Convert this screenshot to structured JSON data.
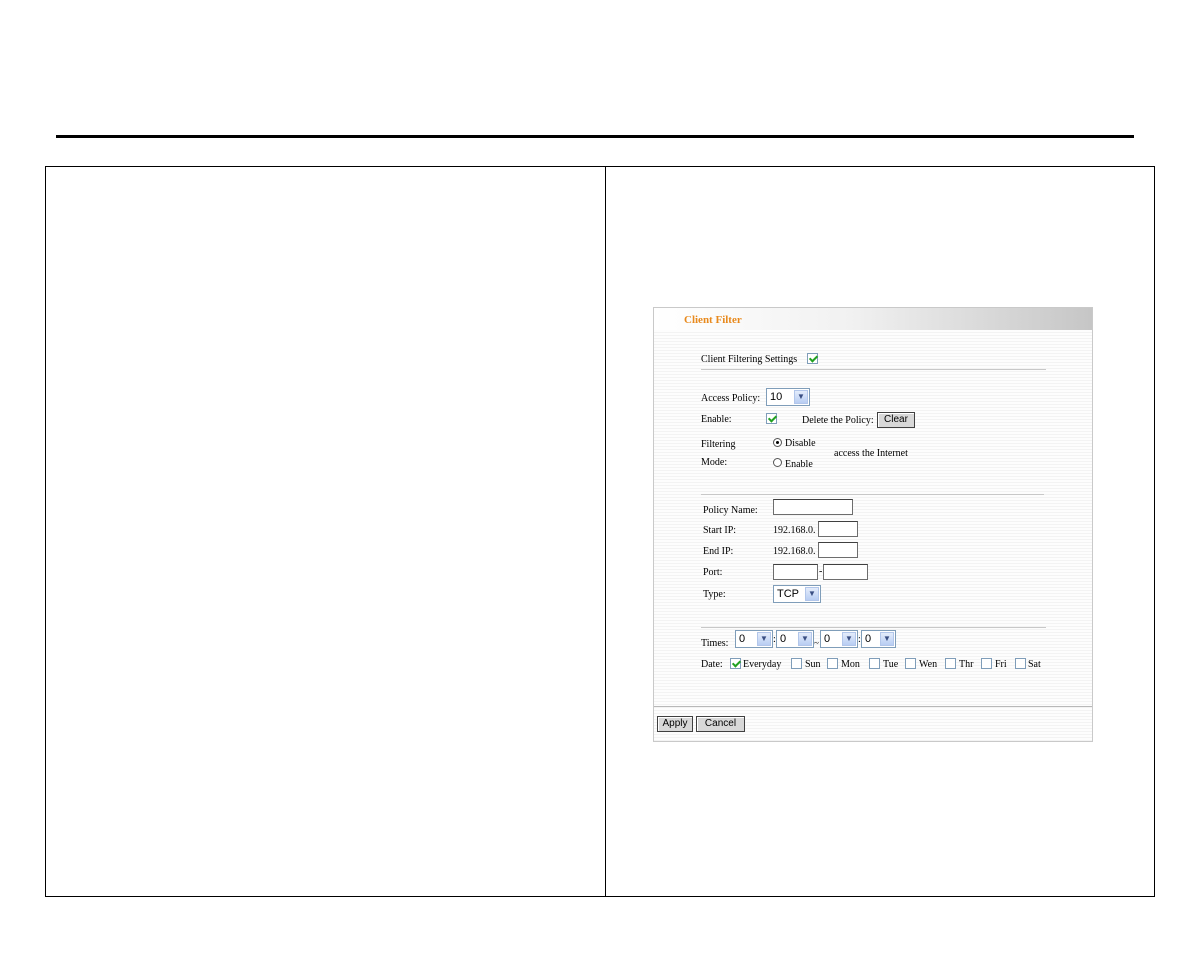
{
  "panel": {
    "title": "Client Filter",
    "client_filtering_settings_label": "Client Filtering Settings",
    "access_policy": {
      "label": "Access Policy:",
      "value": "10"
    },
    "enable_label": "Enable:",
    "delete_policy_label": "Delete the Policy:",
    "clear_button": "Clear",
    "filtering_mode": {
      "label_line1": "Filtering",
      "label_line2": "Mode:",
      "option_disable": "Disable",
      "option_enable": "Enable",
      "suffix": "access the Internet"
    },
    "policy_name_label": "Policy Name:",
    "start_ip": {
      "label": "Start IP:",
      "prefix": "192.168.0."
    },
    "end_ip": {
      "label": "End IP:",
      "prefix": "192.168.0."
    },
    "port_label": "Port:",
    "port_separator": "-",
    "type": {
      "label": "Type:",
      "value": "TCP"
    },
    "times": {
      "label": "Times:",
      "start_hour": "0",
      "start_minute": "0",
      "end_hour": "0",
      "end_minute": "0",
      "colon": ":",
      "range_separator": "~"
    },
    "date": {
      "label": "Date:",
      "days": [
        "Everyday",
        "Sun",
        "Mon",
        "Tue",
        "Wen",
        "Thr",
        "Fri",
        "Sat"
      ]
    },
    "apply_button": "Apply",
    "cancel_button": "Cancel"
  }
}
